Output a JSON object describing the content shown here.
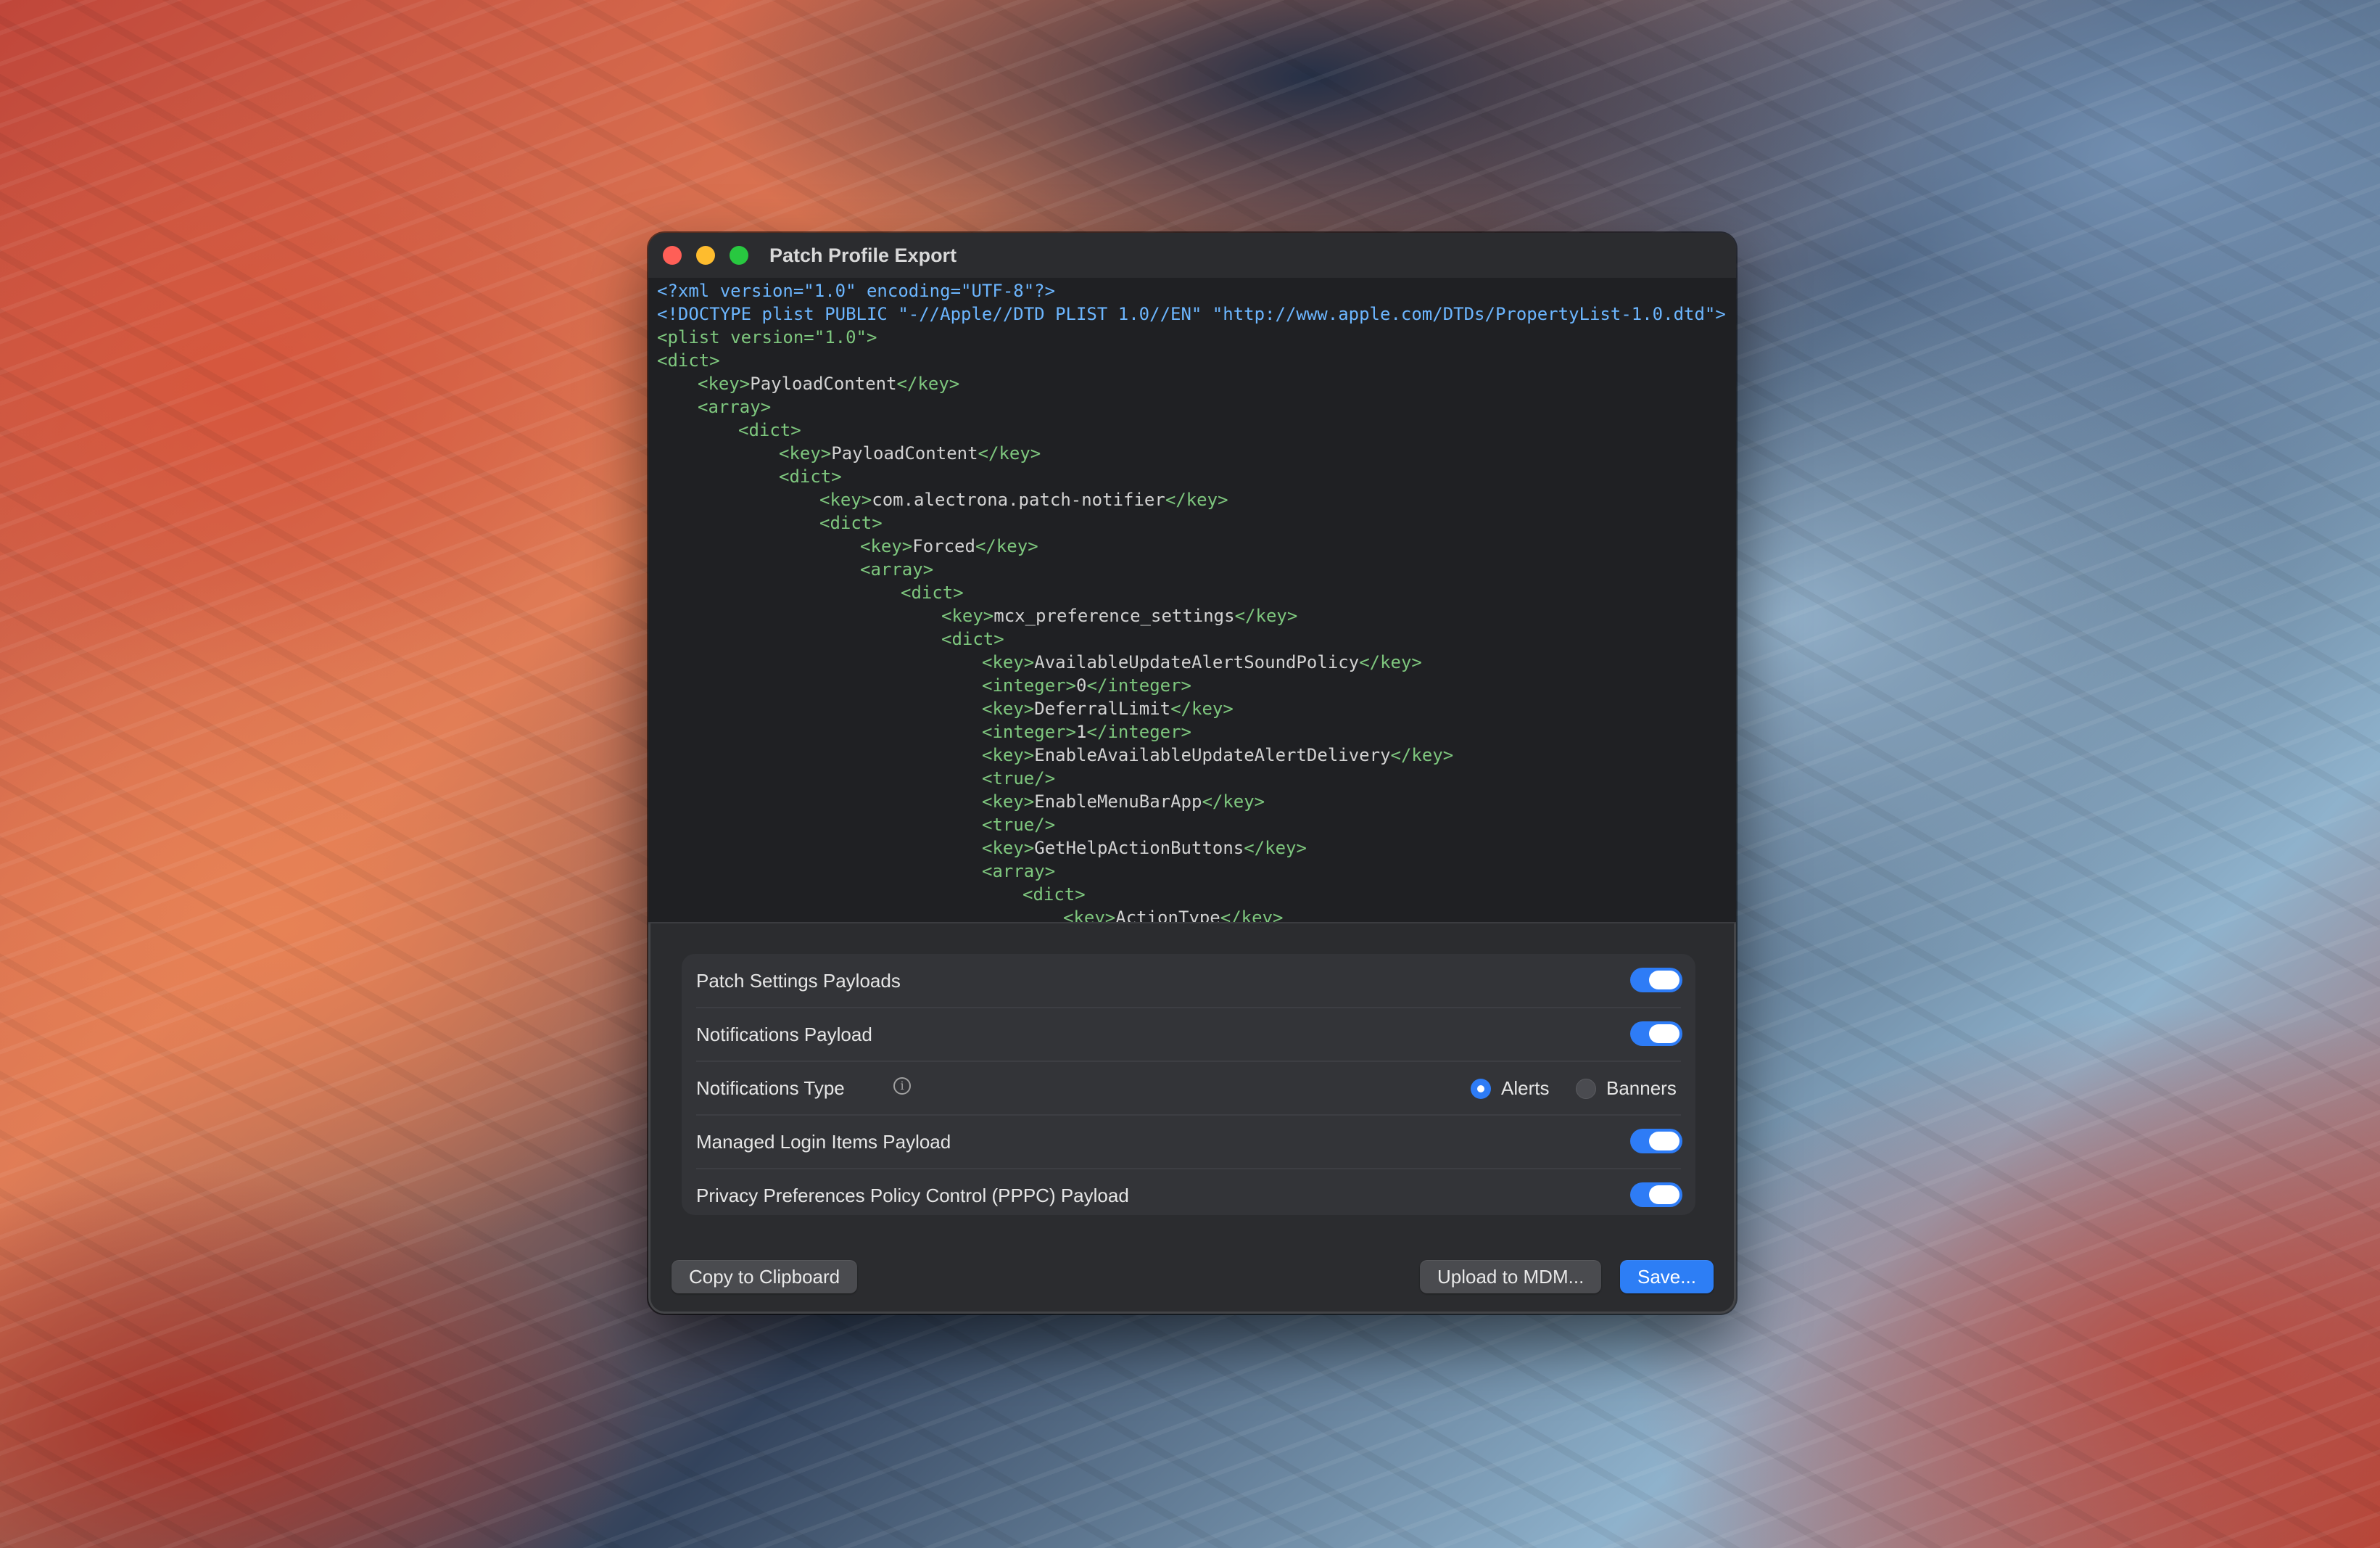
{
  "window": {
    "title": "Patch Profile Export"
  },
  "code": {
    "lines": [
      {
        "indent": 0,
        "parts": [
          {
            "c": "hd",
            "t": "<?xml version=\"1.0\" encoding=\"UTF-8\"?>"
          }
        ]
      },
      {
        "indent": 0,
        "parts": [
          {
            "c": "hd",
            "t": "<!DOCTYPE plist PUBLIC \"-//Apple//DTD PLIST 1.0//EN\" \"http://www.apple.com/DTDs/PropertyList-1.0.dtd\">"
          }
        ]
      },
      {
        "indent": 0,
        "parts": [
          {
            "c": "tg",
            "t": "<plist version=\"1.0\">"
          }
        ]
      },
      {
        "indent": 0,
        "parts": [
          {
            "c": "tg",
            "t": "<dict>"
          }
        ]
      },
      {
        "indent": 1,
        "parts": [
          {
            "c": "tg",
            "t": "<key>"
          },
          {
            "c": "tx",
            "t": "PayloadContent"
          },
          {
            "c": "tg",
            "t": "</key>"
          }
        ]
      },
      {
        "indent": 1,
        "parts": [
          {
            "c": "tg",
            "t": "<array>"
          }
        ]
      },
      {
        "indent": 2,
        "parts": [
          {
            "c": "tg",
            "t": "<dict>"
          }
        ]
      },
      {
        "indent": 3,
        "parts": [
          {
            "c": "tg",
            "t": "<key>"
          },
          {
            "c": "tx",
            "t": "PayloadContent"
          },
          {
            "c": "tg",
            "t": "</key>"
          }
        ]
      },
      {
        "indent": 3,
        "parts": [
          {
            "c": "tg",
            "t": "<dict>"
          }
        ]
      },
      {
        "indent": 4,
        "parts": [
          {
            "c": "tg",
            "t": "<key>"
          },
          {
            "c": "tx",
            "t": "com.alectrona.patch-notifier"
          },
          {
            "c": "tg",
            "t": "</key>"
          }
        ]
      },
      {
        "indent": 4,
        "parts": [
          {
            "c": "tg",
            "t": "<dict>"
          }
        ]
      },
      {
        "indent": 5,
        "parts": [
          {
            "c": "tg",
            "t": "<key>"
          },
          {
            "c": "tx",
            "t": "Forced"
          },
          {
            "c": "tg",
            "t": "</key>"
          }
        ]
      },
      {
        "indent": 5,
        "parts": [
          {
            "c": "tg",
            "t": "<array>"
          }
        ]
      },
      {
        "indent": 6,
        "parts": [
          {
            "c": "tg",
            "t": "<dict>"
          }
        ]
      },
      {
        "indent": 7,
        "parts": [
          {
            "c": "tg",
            "t": "<key>"
          },
          {
            "c": "tx",
            "t": "mcx_preference_settings"
          },
          {
            "c": "tg",
            "t": "</key>"
          }
        ]
      },
      {
        "indent": 7,
        "parts": [
          {
            "c": "tg",
            "t": "<dict>"
          }
        ]
      },
      {
        "indent": 8,
        "parts": [
          {
            "c": "tg",
            "t": "<key>"
          },
          {
            "c": "tx",
            "t": "AvailableUpdateAlertSoundPolicy"
          },
          {
            "c": "tg",
            "t": "</key>"
          }
        ]
      },
      {
        "indent": 8,
        "parts": [
          {
            "c": "tg",
            "t": "<integer>"
          },
          {
            "c": "tx",
            "t": "0"
          },
          {
            "c": "tg",
            "t": "</integer>"
          }
        ]
      },
      {
        "indent": 8,
        "parts": [
          {
            "c": "tg",
            "t": "<key>"
          },
          {
            "c": "tx",
            "t": "DeferralLimit"
          },
          {
            "c": "tg",
            "t": "</key>"
          }
        ]
      },
      {
        "indent": 8,
        "parts": [
          {
            "c": "tg",
            "t": "<integer>"
          },
          {
            "c": "tx",
            "t": "1"
          },
          {
            "c": "tg",
            "t": "</integer>"
          }
        ]
      },
      {
        "indent": 8,
        "parts": [
          {
            "c": "tg",
            "t": "<key>"
          },
          {
            "c": "tx",
            "t": "EnableAvailableUpdateAlertDelivery"
          },
          {
            "c": "tg",
            "t": "</key>"
          }
        ]
      },
      {
        "indent": 8,
        "parts": [
          {
            "c": "tg",
            "t": "<true/>"
          }
        ]
      },
      {
        "indent": 8,
        "parts": [
          {
            "c": "tg",
            "t": "<key>"
          },
          {
            "c": "tx",
            "t": "EnableMenuBarApp"
          },
          {
            "c": "tg",
            "t": "</key>"
          }
        ]
      },
      {
        "indent": 8,
        "parts": [
          {
            "c": "tg",
            "t": "<true/>"
          }
        ]
      },
      {
        "indent": 8,
        "parts": [
          {
            "c": "tg",
            "t": "<key>"
          },
          {
            "c": "tx",
            "t": "GetHelpActionButtons"
          },
          {
            "c": "tg",
            "t": "</key>"
          }
        ]
      },
      {
        "indent": 8,
        "parts": [
          {
            "c": "tg",
            "t": "<array>"
          }
        ]
      },
      {
        "indent": 9,
        "parts": [
          {
            "c": "tg",
            "t": "<dict>"
          }
        ]
      },
      {
        "indent": 10,
        "parts": [
          {
            "c": "tg",
            "t": "<key>"
          },
          {
            "c": "tx",
            "t": "ActionType"
          },
          {
            "c": "tg",
            "t": "</key>"
          }
        ]
      }
    ]
  },
  "settings": {
    "patch_settings_label": "Patch Settings Payloads",
    "patch_settings_on": true,
    "notifications_payload_label": "Notifications Payload",
    "notifications_payload_on": true,
    "notifications_type_label": "Notifications Type",
    "notifications_type_options": [
      "Alerts",
      "Banners"
    ],
    "notifications_type_selected": "Alerts",
    "managed_login_label": "Managed Login Items Payload",
    "managed_login_on": true,
    "pppc_label": "Privacy Preferences Policy Control (PPPC) Payload",
    "pppc_on": true
  },
  "footer": {
    "copy_label": "Copy to Clipboard",
    "upload_label": "Upload to MDM...",
    "save_label": "Save..."
  },
  "colors": {
    "accent": "#2e7cf6",
    "tag": "#7ec77e",
    "header": "#6cb6ff"
  },
  "icons": [
    "close-icon",
    "minimize-icon",
    "zoom-icon",
    "info-icon"
  ]
}
